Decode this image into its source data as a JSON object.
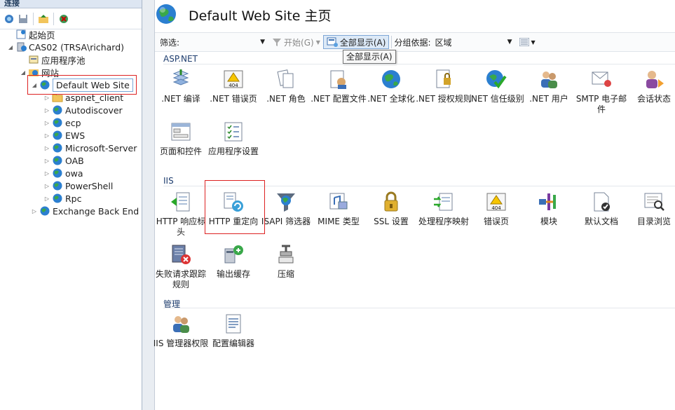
{
  "left_panel": {
    "header": "连接",
    "tree": [
      {
        "label": "起始页",
        "expander": "",
        "icon": "start-page-icon"
      },
      {
        "label": "CAS02 (TRSA\\richard)",
        "expander": "◢",
        "icon": "server-icon"
      },
      {
        "label": "应用程序池",
        "expander": "",
        "icon": "app-pools-icon"
      },
      {
        "label": "网站",
        "expander": "◢",
        "icon": "sites-folder-icon"
      },
      {
        "label": "Default Web Site",
        "expander": "◢",
        "icon": "globe-icon",
        "selected": true
      },
      {
        "label": "aspnet_client",
        "expander": "▷",
        "icon": "folder-icon"
      },
      {
        "label": "Autodiscover",
        "expander": "▷",
        "icon": "globe-icon"
      },
      {
        "label": "ecp",
        "expander": "▷",
        "icon": "globe-icon"
      },
      {
        "label": "EWS",
        "expander": "▷",
        "icon": "globe-icon"
      },
      {
        "label": "Microsoft-Server",
        "expander": "▷",
        "icon": "globe-icon"
      },
      {
        "label": "OAB",
        "expander": "▷",
        "icon": "globe-icon"
      },
      {
        "label": "owa",
        "expander": "▷",
        "icon": "globe-icon"
      },
      {
        "label": "PowerShell",
        "expander": "▷",
        "icon": "globe-icon"
      },
      {
        "label": "Rpc",
        "expander": "▷",
        "icon": "globe-icon"
      },
      {
        "label": "Exchange Back End",
        "expander": "▷",
        "icon": "globe-icon"
      }
    ]
  },
  "main": {
    "title": "Default Web Site 主页",
    "filter": {
      "label": "筛选:",
      "start_label": "开始(G)",
      "show_all_label": "全部显示(A)",
      "group_by_label": "分组依据:",
      "group_by_value": "区域",
      "tooltip": "全部显示(A)"
    },
    "sections": [
      {
        "name": "ASP.NET",
        "items": [
          {
            "label": ".NET 编译",
            "icon": "dotnet-compile-icon"
          },
          {
            "label": ".NET 错误页",
            "icon": "dotnet-error-pages-icon"
          },
          {
            "label": ".NET 角色",
            "icon": "dotnet-roles-icon"
          },
          {
            "label": ".NET 配置文件",
            "icon": "dotnet-profile-icon"
          },
          {
            "label": ".NET 全球化",
            "icon": "dotnet-globalization-icon"
          },
          {
            "label": ".NET 授权规则",
            "icon": "dotnet-authorization-icon"
          },
          {
            "label": ".NET 信任级别",
            "icon": "dotnet-trust-levels-icon"
          },
          {
            "label": ".NET 用户",
            "icon": "dotnet-users-icon"
          },
          {
            "label": "SMTP 电子邮件",
            "icon": "smtp-email-icon"
          },
          {
            "label": "会话状态",
            "icon": "session-state-icon"
          },
          {
            "label": "页面和控件",
            "icon": "pages-controls-icon"
          },
          {
            "label": "应用程序设置",
            "icon": "app-settings-icon"
          }
        ]
      },
      {
        "name": "IIS",
        "items": [
          {
            "label": "HTTP 响应标头",
            "icon": "http-response-headers-icon"
          },
          {
            "label": "HTTP 重定向",
            "icon": "http-redirect-icon"
          },
          {
            "label": "ISAPI 筛选器",
            "icon": "isapi-filters-icon"
          },
          {
            "label": "MIME 类型",
            "icon": "mime-types-icon"
          },
          {
            "label": "SSL 设置",
            "icon": "ssl-lock-icon"
          },
          {
            "label": "处理程序映射",
            "icon": "handler-mappings-icon"
          },
          {
            "label": "错误页",
            "icon": "error-pages-icon"
          },
          {
            "label": "模块",
            "icon": "modules-icon"
          },
          {
            "label": "默认文档",
            "icon": "default-document-icon"
          },
          {
            "label": "目录浏览",
            "icon": "directory-browsing-icon"
          },
          {
            "label": "失败请求跟踪规则",
            "icon": "failed-request-tracing-icon"
          },
          {
            "label": "输出缓存",
            "icon": "output-caching-icon"
          },
          {
            "label": "压缩",
            "icon": "compression-icon"
          }
        ]
      },
      {
        "name": "管理",
        "items": [
          {
            "label": "IIS 管理器权限",
            "icon": "iis-manager-permissions-icon"
          },
          {
            "label": "配置编辑器",
            "icon": "configuration-editor-icon"
          }
        ]
      }
    ]
  }
}
